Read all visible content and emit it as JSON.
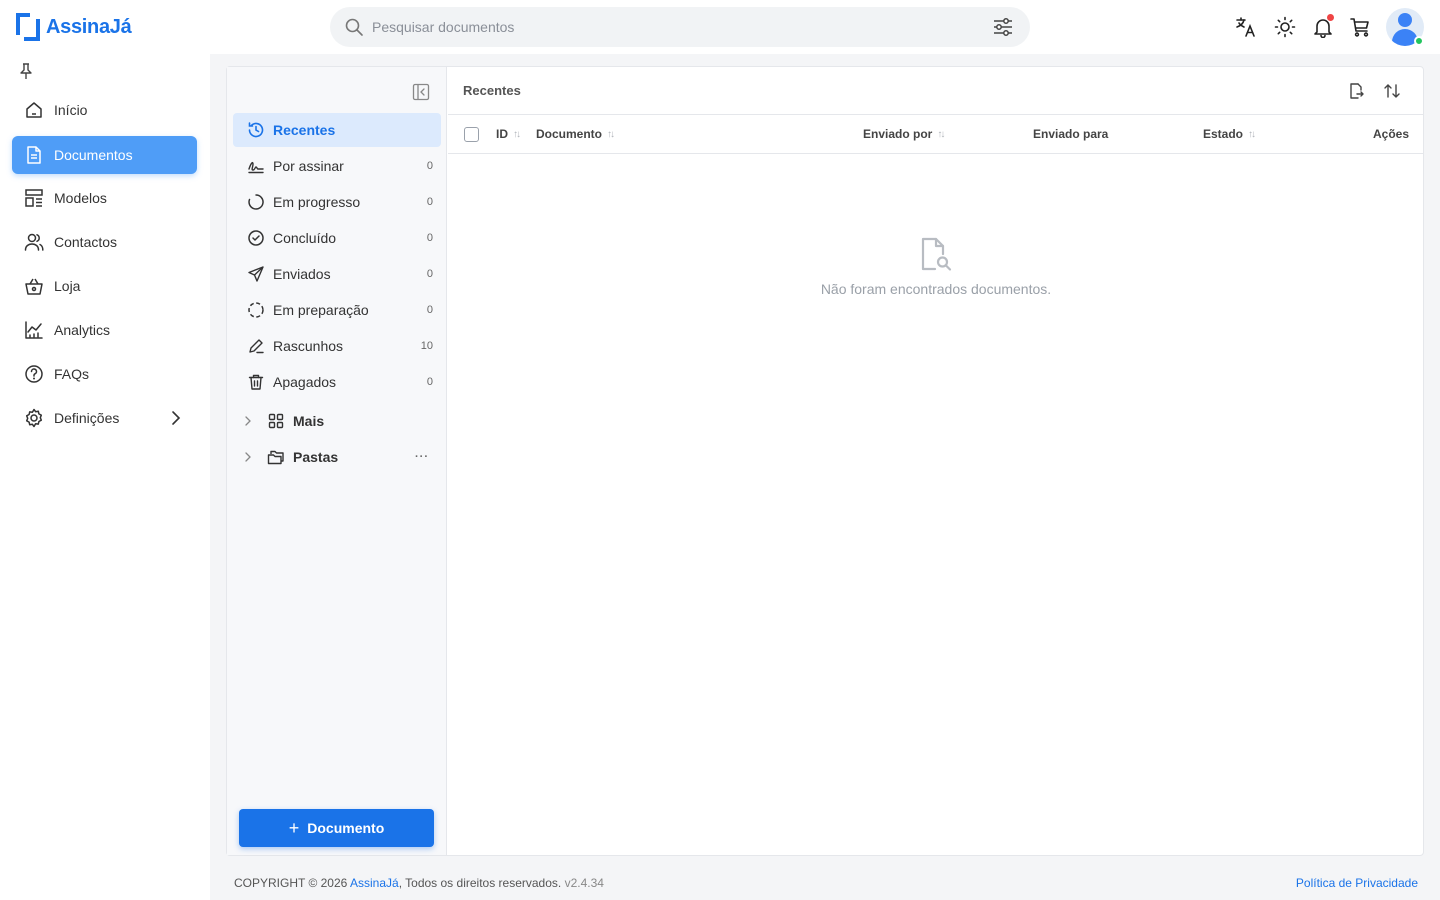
{
  "app": {
    "name": "AssinaJá"
  },
  "search": {
    "placeholder": "Pesquisar documentos"
  },
  "nav": {
    "items": [
      {
        "label": "Início",
        "icon": "home-icon"
      },
      {
        "label": "Documentos",
        "icon": "document-icon",
        "active": true
      },
      {
        "label": "Modelos",
        "icon": "templates-icon"
      },
      {
        "label": "Contactos",
        "icon": "contacts-icon"
      },
      {
        "label": "Loja",
        "icon": "basket-icon"
      },
      {
        "label": "Analytics",
        "icon": "analytics-icon"
      },
      {
        "label": "FAQs",
        "icon": "help-icon"
      },
      {
        "label": "Definições",
        "icon": "gear-icon"
      }
    ]
  },
  "subnav": {
    "items": [
      {
        "label": "Recentes",
        "icon": "history-icon",
        "count": "",
        "active": true
      },
      {
        "label": "Por assinar",
        "icon": "signature-icon",
        "count": "0"
      },
      {
        "label": "Em progresso",
        "icon": "progress-icon",
        "count": "0"
      },
      {
        "label": "Concluído",
        "icon": "check-circle-icon",
        "count": "0"
      },
      {
        "label": "Enviados",
        "icon": "send-icon",
        "count": "0"
      },
      {
        "label": "Em preparação",
        "icon": "dashed-circle-icon",
        "count": "0"
      },
      {
        "label": "Rascunhos",
        "icon": "pencil-icon",
        "count": "10"
      },
      {
        "label": "Apagados",
        "icon": "trash-icon",
        "count": "0"
      }
    ],
    "groups": [
      {
        "label": "Mais",
        "icon": "grid-icon"
      },
      {
        "label": "Pastas",
        "icon": "folders-icon",
        "more": "···"
      }
    ],
    "new_button": "Documento"
  },
  "main": {
    "title": "Recentes",
    "columns": {
      "id": "ID",
      "documento": "Documento",
      "enviado_por": "Enviado por",
      "enviado_para": "Enviado para",
      "estado": "Estado",
      "acoes": "Ações"
    },
    "sort_glyph": "↑↓",
    "empty_text": "Não foram encontrados documentos."
  },
  "footer": {
    "copyright": "COPYRIGHT © 2026 ",
    "brand": "AssinaJá",
    "rights": ", Todos os direitos reservados. ",
    "version": "v2.4.34",
    "privacy": "Política de Privacidade"
  },
  "colors": {
    "accent": "#1a73e8",
    "active_nav": "#4f9df7",
    "active_sub": "#dceafd",
    "notification": "#ef4444",
    "online": "#22c55e"
  }
}
